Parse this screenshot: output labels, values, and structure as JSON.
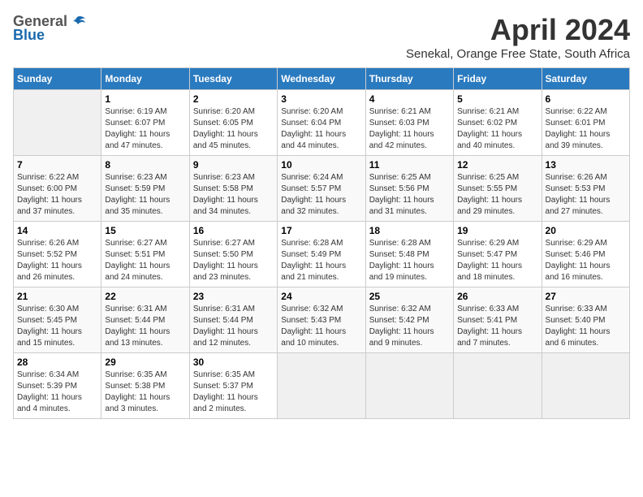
{
  "logo": {
    "general": "General",
    "blue": "Blue"
  },
  "title": "April 2024",
  "subtitle": "Senekal, Orange Free State, South Africa",
  "days_of_week": [
    "Sunday",
    "Monday",
    "Tuesday",
    "Wednesday",
    "Thursday",
    "Friday",
    "Saturday"
  ],
  "weeks": [
    [
      {
        "day": "",
        "info": ""
      },
      {
        "day": "1",
        "info": "Sunrise: 6:19 AM\nSunset: 6:07 PM\nDaylight: 11 hours\nand 47 minutes."
      },
      {
        "day": "2",
        "info": "Sunrise: 6:20 AM\nSunset: 6:05 PM\nDaylight: 11 hours\nand 45 minutes."
      },
      {
        "day": "3",
        "info": "Sunrise: 6:20 AM\nSunset: 6:04 PM\nDaylight: 11 hours\nand 44 minutes."
      },
      {
        "day": "4",
        "info": "Sunrise: 6:21 AM\nSunset: 6:03 PM\nDaylight: 11 hours\nand 42 minutes."
      },
      {
        "day": "5",
        "info": "Sunrise: 6:21 AM\nSunset: 6:02 PM\nDaylight: 11 hours\nand 40 minutes."
      },
      {
        "day": "6",
        "info": "Sunrise: 6:22 AM\nSunset: 6:01 PM\nDaylight: 11 hours\nand 39 minutes."
      }
    ],
    [
      {
        "day": "7",
        "info": "Sunrise: 6:22 AM\nSunset: 6:00 PM\nDaylight: 11 hours\nand 37 minutes."
      },
      {
        "day": "8",
        "info": "Sunrise: 6:23 AM\nSunset: 5:59 PM\nDaylight: 11 hours\nand 35 minutes."
      },
      {
        "day": "9",
        "info": "Sunrise: 6:23 AM\nSunset: 5:58 PM\nDaylight: 11 hours\nand 34 minutes."
      },
      {
        "day": "10",
        "info": "Sunrise: 6:24 AM\nSunset: 5:57 PM\nDaylight: 11 hours\nand 32 minutes."
      },
      {
        "day": "11",
        "info": "Sunrise: 6:25 AM\nSunset: 5:56 PM\nDaylight: 11 hours\nand 31 minutes."
      },
      {
        "day": "12",
        "info": "Sunrise: 6:25 AM\nSunset: 5:55 PM\nDaylight: 11 hours\nand 29 minutes."
      },
      {
        "day": "13",
        "info": "Sunrise: 6:26 AM\nSunset: 5:53 PM\nDaylight: 11 hours\nand 27 minutes."
      }
    ],
    [
      {
        "day": "14",
        "info": "Sunrise: 6:26 AM\nSunset: 5:52 PM\nDaylight: 11 hours\nand 26 minutes."
      },
      {
        "day": "15",
        "info": "Sunrise: 6:27 AM\nSunset: 5:51 PM\nDaylight: 11 hours\nand 24 minutes."
      },
      {
        "day": "16",
        "info": "Sunrise: 6:27 AM\nSunset: 5:50 PM\nDaylight: 11 hours\nand 23 minutes."
      },
      {
        "day": "17",
        "info": "Sunrise: 6:28 AM\nSunset: 5:49 PM\nDaylight: 11 hours\nand 21 minutes."
      },
      {
        "day": "18",
        "info": "Sunrise: 6:28 AM\nSunset: 5:48 PM\nDaylight: 11 hours\nand 19 minutes."
      },
      {
        "day": "19",
        "info": "Sunrise: 6:29 AM\nSunset: 5:47 PM\nDaylight: 11 hours\nand 18 minutes."
      },
      {
        "day": "20",
        "info": "Sunrise: 6:29 AM\nSunset: 5:46 PM\nDaylight: 11 hours\nand 16 minutes."
      }
    ],
    [
      {
        "day": "21",
        "info": "Sunrise: 6:30 AM\nSunset: 5:45 PM\nDaylight: 11 hours\nand 15 minutes."
      },
      {
        "day": "22",
        "info": "Sunrise: 6:31 AM\nSunset: 5:44 PM\nDaylight: 11 hours\nand 13 minutes."
      },
      {
        "day": "23",
        "info": "Sunrise: 6:31 AM\nSunset: 5:44 PM\nDaylight: 11 hours\nand 12 minutes."
      },
      {
        "day": "24",
        "info": "Sunrise: 6:32 AM\nSunset: 5:43 PM\nDaylight: 11 hours\nand 10 minutes."
      },
      {
        "day": "25",
        "info": "Sunrise: 6:32 AM\nSunset: 5:42 PM\nDaylight: 11 hours\nand 9 minutes."
      },
      {
        "day": "26",
        "info": "Sunrise: 6:33 AM\nSunset: 5:41 PM\nDaylight: 11 hours\nand 7 minutes."
      },
      {
        "day": "27",
        "info": "Sunrise: 6:33 AM\nSunset: 5:40 PM\nDaylight: 11 hours\nand 6 minutes."
      }
    ],
    [
      {
        "day": "28",
        "info": "Sunrise: 6:34 AM\nSunset: 5:39 PM\nDaylight: 11 hours\nand 4 minutes."
      },
      {
        "day": "29",
        "info": "Sunrise: 6:35 AM\nSunset: 5:38 PM\nDaylight: 11 hours\nand 3 minutes."
      },
      {
        "day": "30",
        "info": "Sunrise: 6:35 AM\nSunset: 5:37 PM\nDaylight: 11 hours\nand 2 minutes."
      },
      {
        "day": "",
        "info": ""
      },
      {
        "day": "",
        "info": ""
      },
      {
        "day": "",
        "info": ""
      },
      {
        "day": "",
        "info": ""
      }
    ]
  ]
}
